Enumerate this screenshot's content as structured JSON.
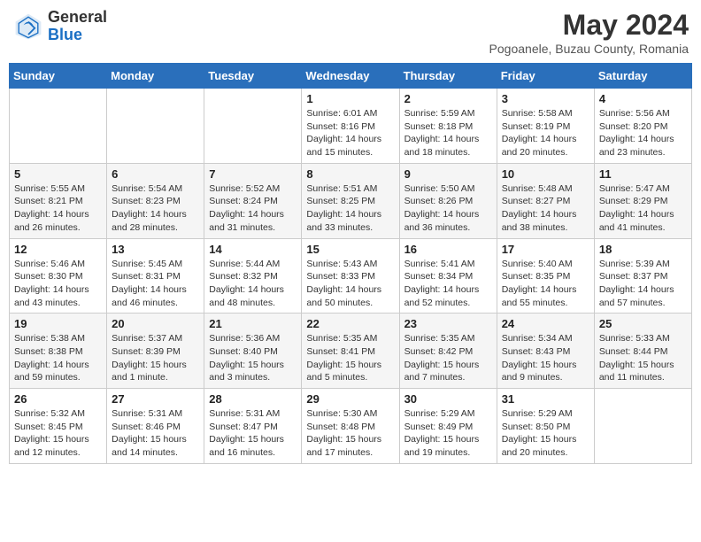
{
  "logo": {
    "general": "General",
    "blue": "Blue"
  },
  "title": {
    "month": "May 2024",
    "location": "Pogoanele, Buzau County, Romania"
  },
  "days_of_week": [
    "Sunday",
    "Monday",
    "Tuesday",
    "Wednesday",
    "Thursday",
    "Friday",
    "Saturday"
  ],
  "weeks": [
    [
      {
        "day": "",
        "info": ""
      },
      {
        "day": "",
        "info": ""
      },
      {
        "day": "",
        "info": ""
      },
      {
        "day": "1",
        "info": "Sunrise: 6:01 AM\nSunset: 8:16 PM\nDaylight: 14 hours and 15 minutes."
      },
      {
        "day": "2",
        "info": "Sunrise: 5:59 AM\nSunset: 8:18 PM\nDaylight: 14 hours and 18 minutes."
      },
      {
        "day": "3",
        "info": "Sunrise: 5:58 AM\nSunset: 8:19 PM\nDaylight: 14 hours and 20 minutes."
      },
      {
        "day": "4",
        "info": "Sunrise: 5:56 AM\nSunset: 8:20 PM\nDaylight: 14 hours and 23 minutes."
      }
    ],
    [
      {
        "day": "5",
        "info": "Sunrise: 5:55 AM\nSunset: 8:21 PM\nDaylight: 14 hours and 26 minutes."
      },
      {
        "day": "6",
        "info": "Sunrise: 5:54 AM\nSunset: 8:23 PM\nDaylight: 14 hours and 28 minutes."
      },
      {
        "day": "7",
        "info": "Sunrise: 5:52 AM\nSunset: 8:24 PM\nDaylight: 14 hours and 31 minutes."
      },
      {
        "day": "8",
        "info": "Sunrise: 5:51 AM\nSunset: 8:25 PM\nDaylight: 14 hours and 33 minutes."
      },
      {
        "day": "9",
        "info": "Sunrise: 5:50 AM\nSunset: 8:26 PM\nDaylight: 14 hours and 36 minutes."
      },
      {
        "day": "10",
        "info": "Sunrise: 5:48 AM\nSunset: 8:27 PM\nDaylight: 14 hours and 38 minutes."
      },
      {
        "day": "11",
        "info": "Sunrise: 5:47 AM\nSunset: 8:29 PM\nDaylight: 14 hours and 41 minutes."
      }
    ],
    [
      {
        "day": "12",
        "info": "Sunrise: 5:46 AM\nSunset: 8:30 PM\nDaylight: 14 hours and 43 minutes."
      },
      {
        "day": "13",
        "info": "Sunrise: 5:45 AM\nSunset: 8:31 PM\nDaylight: 14 hours and 46 minutes."
      },
      {
        "day": "14",
        "info": "Sunrise: 5:44 AM\nSunset: 8:32 PM\nDaylight: 14 hours and 48 minutes."
      },
      {
        "day": "15",
        "info": "Sunrise: 5:43 AM\nSunset: 8:33 PM\nDaylight: 14 hours and 50 minutes."
      },
      {
        "day": "16",
        "info": "Sunrise: 5:41 AM\nSunset: 8:34 PM\nDaylight: 14 hours and 52 minutes."
      },
      {
        "day": "17",
        "info": "Sunrise: 5:40 AM\nSunset: 8:35 PM\nDaylight: 14 hours and 55 minutes."
      },
      {
        "day": "18",
        "info": "Sunrise: 5:39 AM\nSunset: 8:37 PM\nDaylight: 14 hours and 57 minutes."
      }
    ],
    [
      {
        "day": "19",
        "info": "Sunrise: 5:38 AM\nSunset: 8:38 PM\nDaylight: 14 hours and 59 minutes."
      },
      {
        "day": "20",
        "info": "Sunrise: 5:37 AM\nSunset: 8:39 PM\nDaylight: 15 hours and 1 minute."
      },
      {
        "day": "21",
        "info": "Sunrise: 5:36 AM\nSunset: 8:40 PM\nDaylight: 15 hours and 3 minutes."
      },
      {
        "day": "22",
        "info": "Sunrise: 5:35 AM\nSunset: 8:41 PM\nDaylight: 15 hours and 5 minutes."
      },
      {
        "day": "23",
        "info": "Sunrise: 5:35 AM\nSunset: 8:42 PM\nDaylight: 15 hours and 7 minutes."
      },
      {
        "day": "24",
        "info": "Sunrise: 5:34 AM\nSunset: 8:43 PM\nDaylight: 15 hours and 9 minutes."
      },
      {
        "day": "25",
        "info": "Sunrise: 5:33 AM\nSunset: 8:44 PM\nDaylight: 15 hours and 11 minutes."
      }
    ],
    [
      {
        "day": "26",
        "info": "Sunrise: 5:32 AM\nSunset: 8:45 PM\nDaylight: 15 hours and 12 minutes."
      },
      {
        "day": "27",
        "info": "Sunrise: 5:31 AM\nSunset: 8:46 PM\nDaylight: 15 hours and 14 minutes."
      },
      {
        "day": "28",
        "info": "Sunrise: 5:31 AM\nSunset: 8:47 PM\nDaylight: 15 hours and 16 minutes."
      },
      {
        "day": "29",
        "info": "Sunrise: 5:30 AM\nSunset: 8:48 PM\nDaylight: 15 hours and 17 minutes."
      },
      {
        "day": "30",
        "info": "Sunrise: 5:29 AM\nSunset: 8:49 PM\nDaylight: 15 hours and 19 minutes."
      },
      {
        "day": "31",
        "info": "Sunrise: 5:29 AM\nSunset: 8:50 PM\nDaylight: 15 hours and 20 minutes."
      },
      {
        "day": "",
        "info": ""
      }
    ]
  ]
}
